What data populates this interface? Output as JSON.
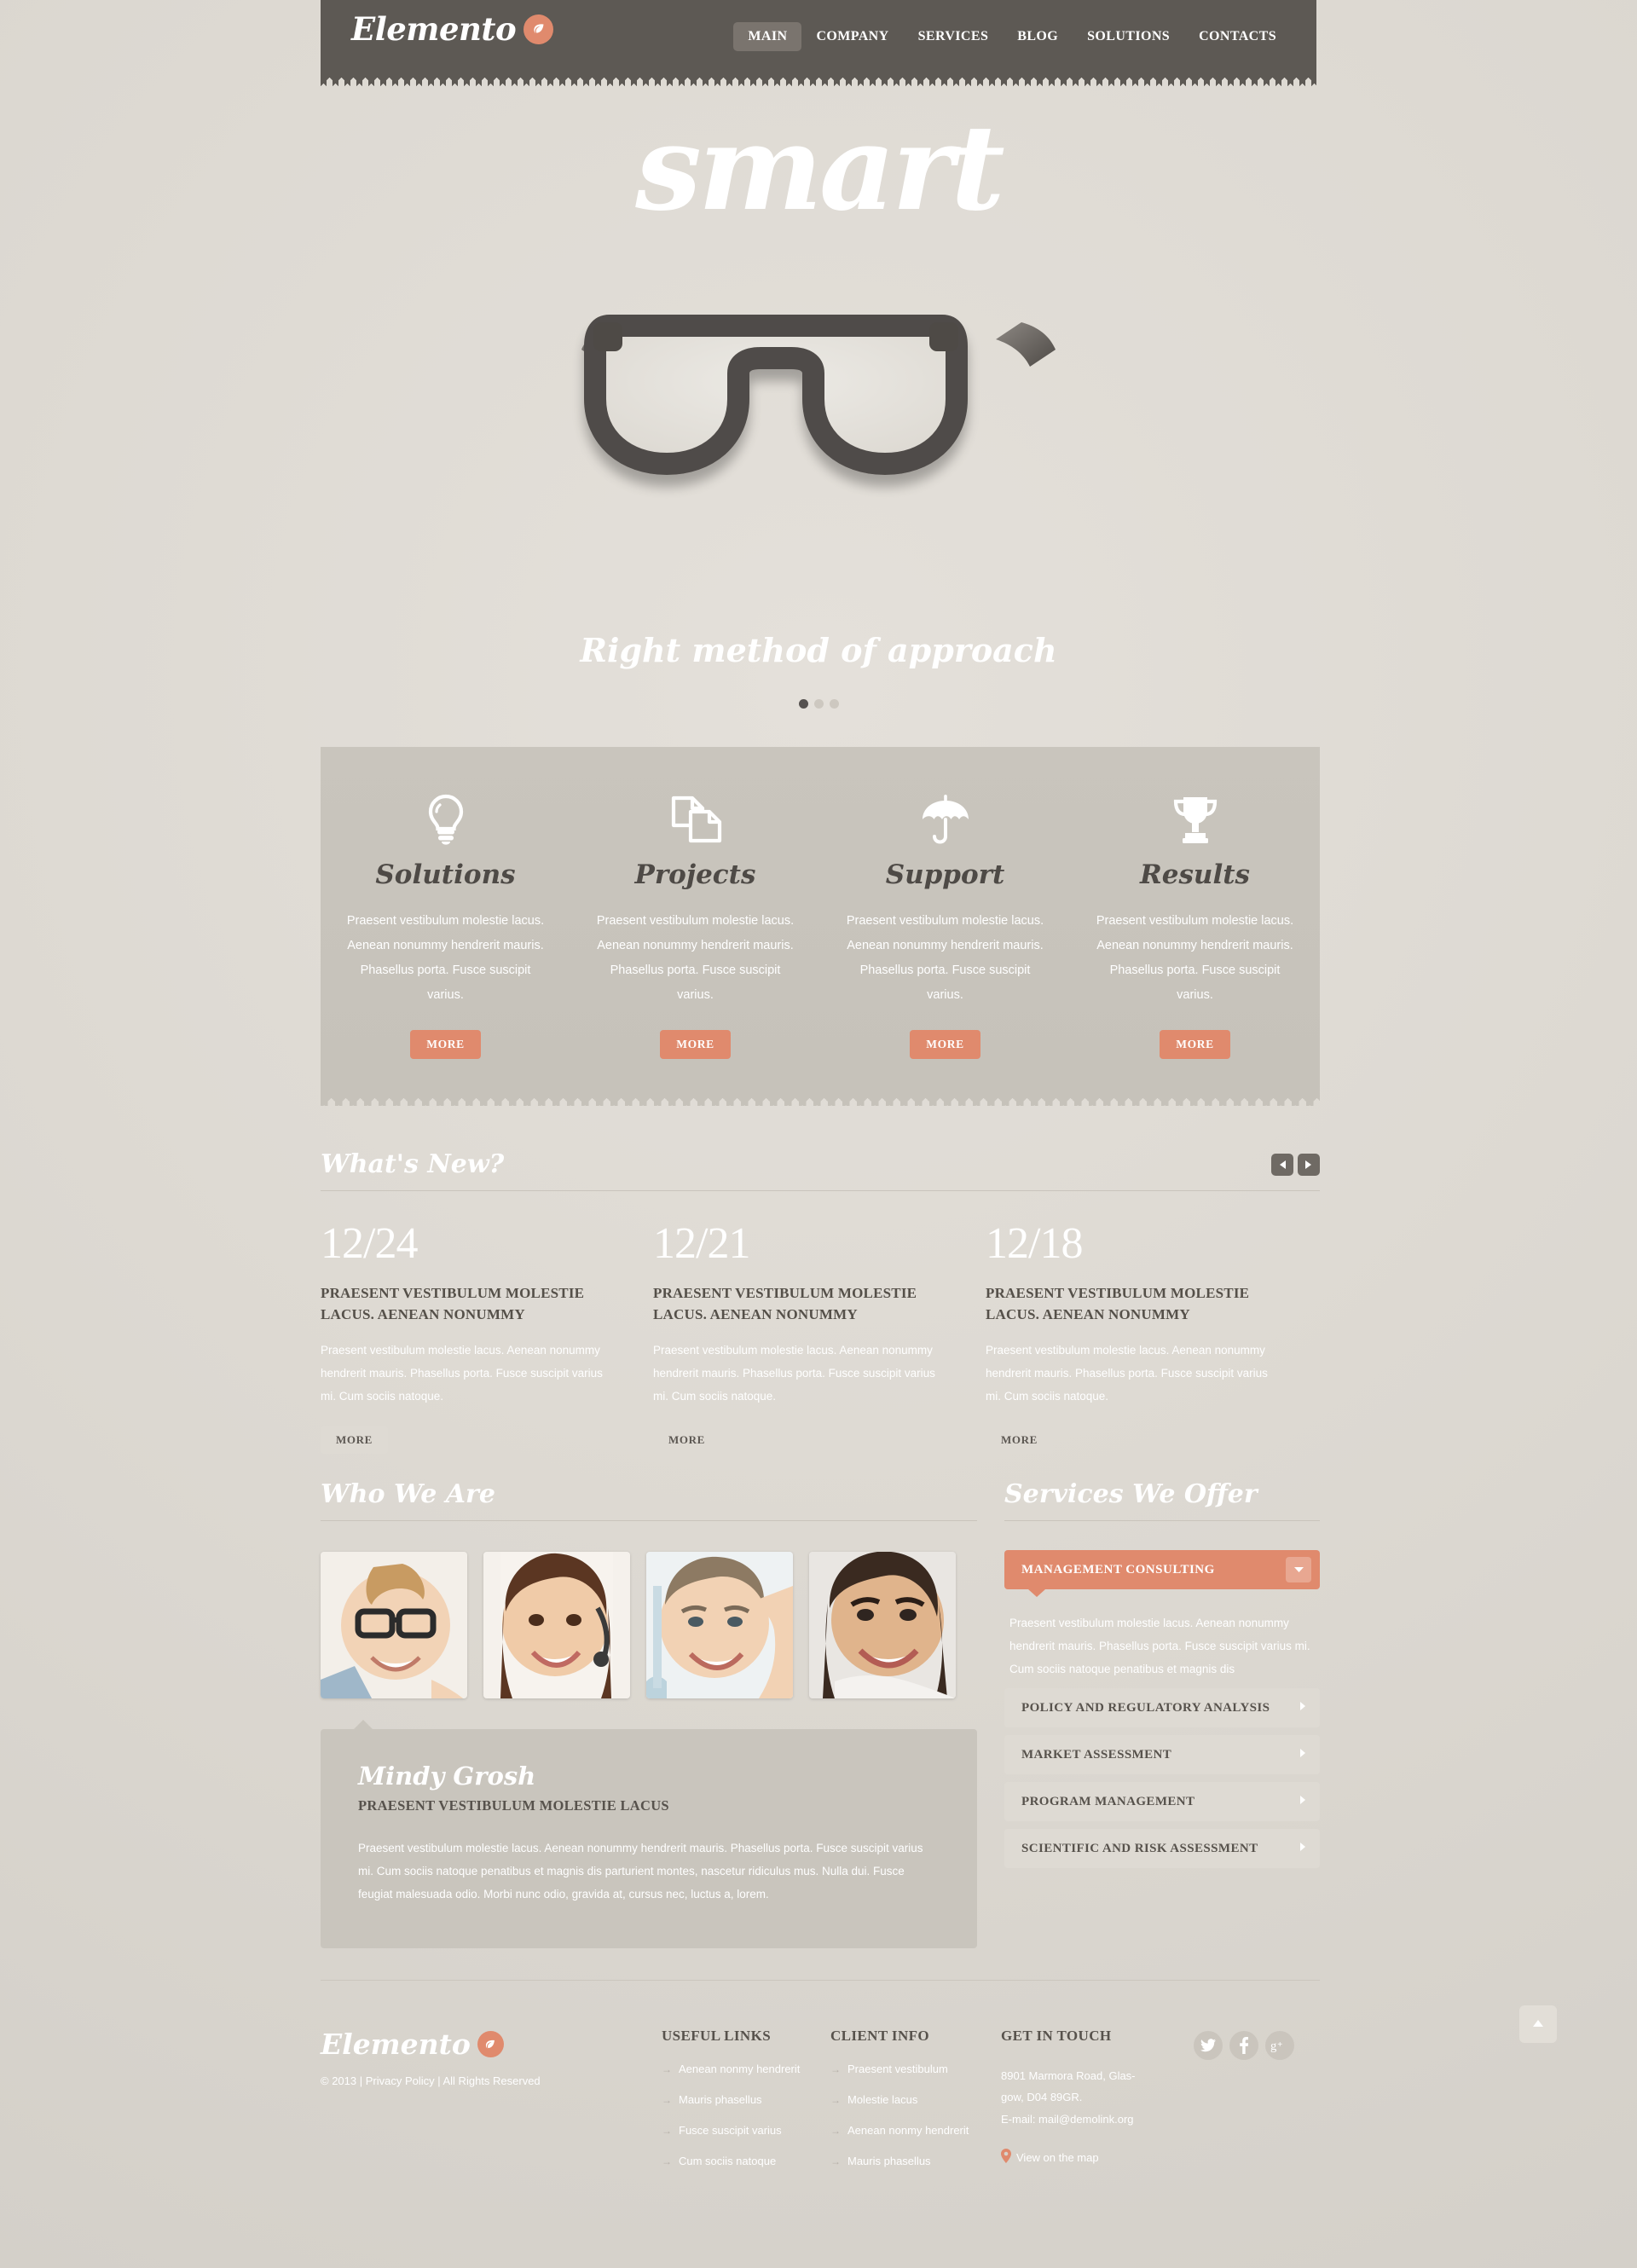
{
  "brand": {
    "name": "Elemento",
    "accent": "#e08a6d",
    "dark": "#5d5954",
    "leaf_icon": "leaf-icon"
  },
  "nav": {
    "items": [
      {
        "label": "MAIN",
        "active": true
      },
      {
        "label": "COMPANY",
        "active": false
      },
      {
        "label": "SERVICES",
        "active": false
      },
      {
        "label": "BLOG",
        "active": false
      },
      {
        "label": "SOLUTIONS",
        "active": false
      },
      {
        "label": "CONTACTS",
        "active": false
      }
    ]
  },
  "hero": {
    "title": "smart",
    "subtitle": "Right method of approach",
    "image": "eyeglasses-illustration",
    "slides": 3,
    "active_slide": 1
  },
  "features": [
    {
      "icon": "lightbulb-icon",
      "title": "Solutions",
      "text": "Praesent vestibulum molestie lacus. Aenean nonummy hendrerit mauris. Phasellus porta. Fusce suscipit varius.",
      "button": "MORE"
    },
    {
      "icon": "documents-icon",
      "title": "Projects",
      "text": "Praesent vestibulum molestie lacus. Aenean nonummy hendrerit mauris. Phasellus porta. Fusce suscipit varius.",
      "button": "MORE"
    },
    {
      "icon": "umbrella-icon",
      "title": "Support",
      "text": "Praesent vestibulum molestie lacus. Aenean nonummy hendrerit mauris. Phasellus porta. Fusce suscipit varius.",
      "button": "MORE"
    },
    {
      "icon": "trophy-icon",
      "title": "Results",
      "text": "Praesent vestibulum molestie lacus. Aenean nonummy hendrerit mauris. Phasellus porta. Fusce suscipit varius.",
      "button": "MORE"
    }
  ],
  "whats_new": {
    "heading": "What's New?",
    "prev_icon": "caret-left-icon",
    "next_icon": "caret-right-icon",
    "items": [
      {
        "date": "12/24",
        "title": "PRAESENT VESTIBULUM MOLESTIE LACUS. AENEAN NONUMMY",
        "text": "Praesent vestibulum molestie lacus. Aenean nonummy hendrerit mauris. Phasellus porta. Fusce suscipit varius mi. Cum sociis natoque.",
        "button": "MORE"
      },
      {
        "date": "12/21",
        "title": "PRAESENT VESTIBULUM MOLESTIE LACUS. AENEAN NONUMMY",
        "text": "Praesent vestibulum molestie lacus. Aenean nonummy hendrerit mauris. Phasellus porta. Fusce suscipit varius mi. Cum sociis natoque.",
        "button": "MORE"
      },
      {
        "date": "12/18",
        "title": "PRAESENT VESTIBULUM MOLESTIE LACUS. AENEAN NONUMMY",
        "text": "Praesent vestibulum molestie lacus. Aenean nonummy hendrerit mauris. Phasellus porta. Fusce suscipit varius mi. Cum sociis natoque.",
        "button": "MORE"
      }
    ]
  },
  "who_we_are": {
    "heading": "Who We Are",
    "team": [
      {
        "alt": "man-with-glasses-photo"
      },
      {
        "alt": "woman-with-headset-photo"
      },
      {
        "alt": "smiling-man-photo"
      },
      {
        "alt": "smiling-woman-photo"
      }
    ],
    "testimonial": {
      "name": "Mindy Grosh",
      "subtitle": "PRAESENT VESTIBULUM MOLESTIE LACUS",
      "body": "Praesent vestibulum molestie lacus. Aenean nonummy hendrerit mauris. Phasellus porta. Fusce suscipit varius mi. Cum sociis natoque penatibus et magnis dis parturient montes, nascetur ridiculus mus. Nulla dui. Fusce feugiat malesuada odio. Morbi nunc odio, gravida at, cursus nec, luctus a, lorem."
    }
  },
  "services_offer": {
    "heading": "Services We Offer",
    "active": {
      "label": "MANAGEMENT CONSULTING",
      "caret_icon": "chevron-down-icon",
      "body": "Praesent vestibulum molestie lacus. Aenean nonummy hendrerit mauris. Phasellus porta. Fusce suscipit varius mi. Cum sociis natoque penatibus et magnis dis"
    },
    "items": [
      {
        "label": "POLICY AND REGULATORY ANALYSIS",
        "caret_icon": "chevron-right-icon"
      },
      {
        "label": "MARKET ASSESSMENT",
        "caret_icon": "chevron-right-icon"
      },
      {
        "label": "PROGRAM MANAGEMENT",
        "caret_icon": "chevron-right-icon"
      },
      {
        "label": "SCIENTIFIC AND RISK ASSESSMENT",
        "caret_icon": "chevron-right-icon"
      }
    ]
  },
  "footer": {
    "copyright": "© 2013  |  Privacy Policy  |  All Rights Reserved",
    "useful_links": {
      "heading": "USEFUL LINKS",
      "items": [
        "Aenean nonmy hendrerit",
        "Mauris phasellus",
        "Fusce suscipit varius",
        "Cum sociis natoque"
      ]
    },
    "client_info": {
      "heading": "CLIENT INFO",
      "items": [
        "Praesent vestibulum",
        "Molestie lacus",
        "Aenean nonmy hendrerit",
        "Mauris phasellus"
      ]
    },
    "get_in_touch": {
      "heading": "GET IN TOUCH",
      "address_line1": "8901 Marmora Road, Glas-",
      "address_line2": "gow, D04 89GR.",
      "email_line": "E-mail: mail@demolink.org",
      "map_link": "View on the map",
      "map_icon": "map-pin-icon"
    },
    "socials": [
      {
        "name": "twitter-icon"
      },
      {
        "name": "facebook-icon"
      },
      {
        "name": "google-plus-icon"
      }
    ],
    "to_top_icon": "caret-up-icon"
  }
}
